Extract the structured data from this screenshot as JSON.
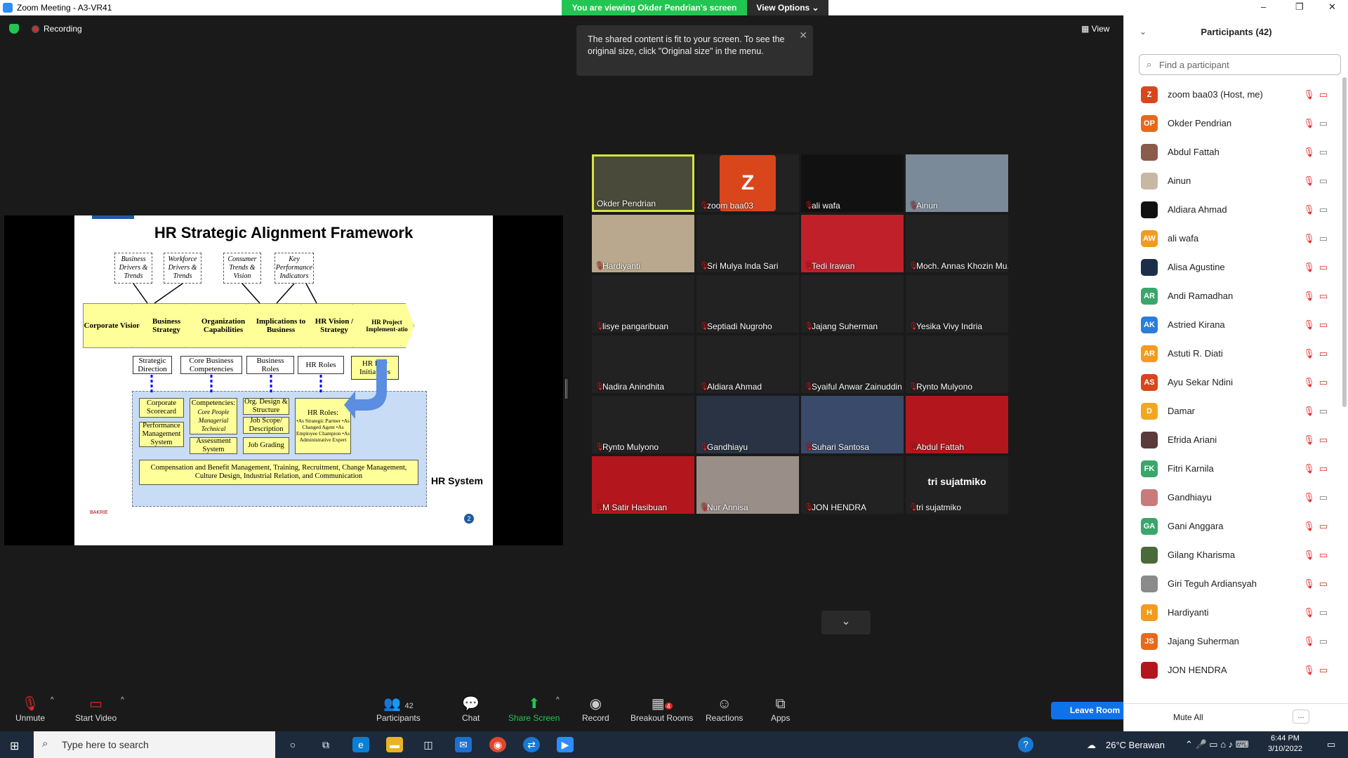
{
  "window": {
    "title": "Zoom Meeting - A3-VR41",
    "min": "–",
    "max": "❐",
    "close": "✕"
  },
  "banner": {
    "viewing": "You are viewing Okder Pendrian's screen",
    "options": "View Options ⌄"
  },
  "status": {
    "recording": "Recording",
    "view": "View"
  },
  "tooltip": {
    "text": "The shared content is fit to your screen. To see the original size, click \"Original size\" in the menu."
  },
  "slide": {
    "title": "HR Strategic Alignment Framework",
    "drivers": [
      "Business Drivers & Trends",
      "Workforce Drivers & Trends",
      "Consumer Trends & Vision",
      "Key Performance Indicators"
    ],
    "chevrons": [
      "Corporate Vision",
      "Business Strategy",
      "Organization Capabilities",
      "Implications to Business",
      "HR Vision / Strategy",
      "HR Project Implement-atio"
    ],
    "boxes": [
      "Strategic Direction",
      "Core Business Competencies",
      "Business Roles",
      "HR Roles",
      "HR Key Initiatives"
    ],
    "sys": {
      "scorecard": "Corporate Scorecard",
      "pms": "Performance Management System",
      "competencies": "Competencies:",
      "comp_sub": "Core People Managerial Technical",
      "assessment": "Assessment System",
      "orgdesign": "Org. Design & Structure",
      "jobscope": "Job Scope/ Description",
      "jobgrading": "Job Grading",
      "hrroles": "HR Roles:",
      "hrroles_sub": "•As Strategic Partner •As Changed Agent •As Employee Champion •As Administrative Expert",
      "comp": "Compensation and Benefit Management, Training, Recruitment, Change Management, Culture Design, Industrial Relation, and Communication"
    },
    "hrsystem": "HR System",
    "logo": "BAKRIE",
    "page": "2"
  },
  "tiles": [
    {
      "name": "Okder Pendrian",
      "bg": "#4a4a3a",
      "active": true,
      "muted": false
    },
    {
      "name": "zoom baa03",
      "bg": "#222",
      "letter": "Z",
      "letterbg": "#d9461b",
      "muted": true
    },
    {
      "name": "ali wafa",
      "bg": "#111",
      "muted": true
    },
    {
      "name": "Ainun",
      "bg": "#7a8a99",
      "muted": true
    },
    {
      "name": "Hardiyanti",
      "bg": "#b9a88d",
      "muted": true
    },
    {
      "name": "Sri Mulya Inda Sari",
      "bg": "#222",
      "muted": true
    },
    {
      "name": "Tedi Irawan",
      "bg": "#c0202a",
      "muted": true
    },
    {
      "name": "Moch. Annas Khozin Mu...",
      "bg": "#222",
      "muted": true
    },
    {
      "name": "lisye pangaribuan",
      "bg": "#222",
      "muted": true
    },
    {
      "name": "Septiadi Nugroho",
      "bg": "#222",
      "muted": true
    },
    {
      "name": "Jajang Suherman",
      "bg": "#222",
      "muted": true
    },
    {
      "name": "Yesika Vivy Indria",
      "bg": "#222",
      "muted": true
    },
    {
      "name": "Nadira Anindhita",
      "bg": "#222",
      "muted": true
    },
    {
      "name": "Aldiara Ahmad",
      "bg": "#222",
      "muted": true
    },
    {
      "name": "Syaiful Anwar Zainuddin",
      "bg": "#222",
      "muted": true
    },
    {
      "name": "Rynto Mulyono",
      "bg": "#222",
      "muted": true
    },
    {
      "name": "Rynto Mulyono",
      "bg": "#222",
      "muted": true
    },
    {
      "name": "Gandhiayu",
      "bg": "#2a3344",
      "muted": true
    },
    {
      "name": "Suhari Santosa",
      "bg": "#3a4a6a",
      "muted": true
    },
    {
      "name": "Abdul Fattah",
      "bg": "#b3171d",
      "muted": true
    },
    {
      "name": "M Satir Hasibuan",
      "bg": "#b3171d",
      "muted": true
    },
    {
      "name": "Nur Annisa",
      "bg": "#9a8f88",
      "muted": true
    },
    {
      "name": "JON HENDRA",
      "bg": "#222",
      "muted": true
    },
    {
      "name": "tri sujatmiko",
      "bg": "#222",
      "center": "tri sujatmiko",
      "muted": true
    }
  ],
  "toolbar": {
    "unmute": "Unmute",
    "startvideo": "Start Video",
    "participants": "Participants",
    "pcount": "42",
    "chat": "Chat",
    "share": "Share Screen",
    "record": "Record",
    "breakout": "Breakout Rooms",
    "breakout_badge": "4",
    "reactions": "Reactions",
    "apps": "Apps",
    "leave": "Leave Room"
  },
  "panel": {
    "title": "Participants (42)",
    "search_placeholder": "Find a participant",
    "mute_all": "Mute All",
    "more": "...",
    "items": [
      {
        "name": "zoom baa03 (Host, me)",
        "av": "Z",
        "color": "#d9461b",
        "video": "off"
      },
      {
        "name": "Okder Pendrian",
        "av": "OP",
        "color": "#e66a1b",
        "video": "on"
      },
      {
        "name": "Abdul Fattah",
        "av": "",
        "color": "#8a5a4a",
        "video": "on"
      },
      {
        "name": "Ainun",
        "av": "",
        "color": "#c9b7a5",
        "video": "on"
      },
      {
        "name": "Aldiara Ahmad",
        "av": "",
        "color": "#111111",
        "video": "on"
      },
      {
        "name": "ali wafa",
        "av": "AW",
        "color": "#f29b1e",
        "video": "on"
      },
      {
        "name": "Alisa Agustine",
        "av": "",
        "color": "#1c2e4a",
        "video": "off"
      },
      {
        "name": "Andi Ramadhan",
        "av": "AR",
        "color": "#3aa66a",
        "video": "off"
      },
      {
        "name": "Astried Kirana",
        "av": "AK",
        "color": "#2a7ed8",
        "video": "off"
      },
      {
        "name": "Astuti R. Diati",
        "av": "AR",
        "color": "#f29b1e",
        "video": "off"
      },
      {
        "name": "Ayu Sekar Ndini",
        "av": "AS",
        "color": "#d9461b",
        "video": "off"
      },
      {
        "name": "Damar",
        "av": "D",
        "color": "#f2a81e",
        "video": "on"
      },
      {
        "name": "Efrida Ariani",
        "av": "",
        "color": "#5a3a3a",
        "video": "off"
      },
      {
        "name": "Fitri Karnila",
        "av": "FK",
        "color": "#3aa66a",
        "video": "off"
      },
      {
        "name": "Gandhiayu",
        "av": "",
        "color": "#c97a7a",
        "video": "on"
      },
      {
        "name": "Gani Anggara",
        "av": "GA",
        "color": "#3aa66a",
        "video": "off"
      },
      {
        "name": "Gilang Kharisma",
        "av": "",
        "color": "#4a6a3a",
        "video": "off"
      },
      {
        "name": "Giri Teguh Ardiansyah",
        "av": "",
        "color": "#8a8a8a",
        "video": "off"
      },
      {
        "name": "Hardiyanti",
        "av": "H",
        "color": "#f29b1e",
        "video": "on"
      },
      {
        "name": "Jajang Suherman",
        "av": "JS",
        "color": "#e66a1b",
        "video": "on"
      },
      {
        "name": "JON HENDRA",
        "av": "",
        "color": "#b3171d",
        "video": "off"
      }
    ]
  },
  "taskbar": {
    "search": "Type here to search",
    "weather": "26°C  Berawan",
    "time": "6:44 PM",
    "date": "3/10/2022"
  }
}
